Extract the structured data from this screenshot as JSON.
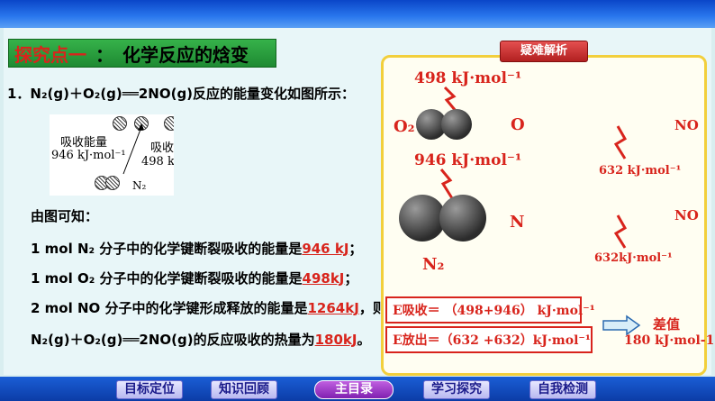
{
  "section": {
    "title": "探究点一",
    "separator": "：",
    "subtitle": "化学反应的焓变"
  },
  "question": {
    "line1": "1．N₂(g)＋O₂(g)══2NO(g)反应的能量变化如图所示：",
    "diagram": {
      "absorb_label": "吸收能量",
      "absorb_value": "946 kJ·mol⁻¹",
      "right_label": "吸收",
      "right_value": "498 k",
      "n2_label": "N₂"
    },
    "conclusion": "由图可知：",
    "l_n2": "1 mol N₂ 分子中的化学键断裂吸收的能量是",
    "a_n2": "946 kJ",
    "e_n2": "；",
    "l_o2": "1 mol O₂ 分子中的化学键断裂吸收的能量是",
    "a_o2": "498kJ",
    "e_o2": "；",
    "l_no": "2 mol NO 分子中的化学键形成释放的能量是",
    "a_no": "1264kJ",
    "e_no": "，则",
    "l_total": "N₂(g)＋O₂(g)══2NO(g)的反应吸收的热量为",
    "a_total": "180kJ",
    "e_total": "。"
  },
  "panel": {
    "badge": "疑难解析",
    "o2_energy": "498 kJ·mol⁻¹",
    "o2_label": "O₂",
    "o_label": "O",
    "no_label_1": "NO",
    "n2_energy": "946 kJ·mol⁻¹",
    "no_energy_1": "632 kJ·mol⁻¹",
    "n_label": "N",
    "no_label_2": "NO",
    "no_energy_2": "632kJ·mol⁻¹",
    "n2_label": "N₂",
    "e_absorb": "E吸收＝ （498+946） kJ·mol⁻¹",
    "e_release": "E放出＝（632 +632）kJ·mol⁻¹",
    "diff_label": "差值",
    "diff_value": "180 kJ·mol-1"
  },
  "nav": {
    "goal": "目标定位",
    "review": "知识回顾",
    "main": "主目录",
    "explore": "学习探究",
    "test": "自我检测"
  }
}
